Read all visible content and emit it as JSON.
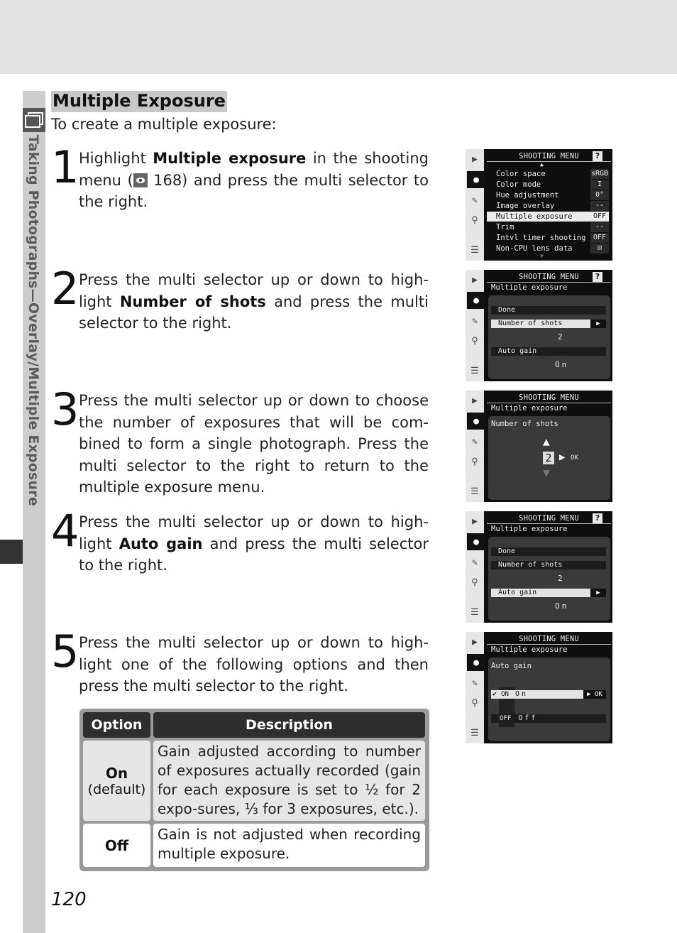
{
  "page": {
    "section_tab": "Taking Photographs—Overlay/Multiple Exposure",
    "title": "Multiple Exposure",
    "intro": "To create a multiple exposure:",
    "page_number": "120"
  },
  "steps": [
    {
      "num": "1",
      "parts": [
        "Highlight ",
        "Multiple exposure",
        " in the shooting menu (",
        "168) and press the multi selector to the right."
      ],
      "ref_icon": "menu-guide-icon"
    },
    {
      "num": "2",
      "parts": [
        "Press the multi selector up or down to high-light ",
        "Number of shots",
        " and press the multi selector to the right."
      ]
    },
    {
      "num": "3",
      "text": "Press the multi selector up or down to choose the number of exposures that will be com-bined to form a single photograph.  Press the multi selector to the right to return to the multiple exposure menu."
    },
    {
      "num": "4",
      "parts": [
        "Press the multi selector up or down to high-light ",
        "Auto gain",
        " and press the multi selector to the right."
      ]
    },
    {
      "num": "5",
      "text": "Press the multi selector up or down to high-light one of the following options and then press the multi selector to the right."
    }
  ],
  "table": {
    "headers": [
      "Option",
      "Description"
    ],
    "rows": [
      {
        "option": "On",
        "note": "(default)",
        "description": "Gain adjusted according to number of exposures actually recorded (gain for each exposure is set to ½ for 2 expo-sures, ⅓ for 3 exposures, etc.)."
      },
      {
        "option": "Off",
        "note": "",
        "description": "Gain is not adjusted when recording multiple exposure."
      }
    ]
  },
  "screens": {
    "header": "SHOOTING MENU",
    "help": "?",
    "submenu_title": "Multiple exposure",
    "rail_icons": [
      "playback-icon",
      "camera-icon",
      "pencil-icon",
      "wrench-icon",
      "custom-menu-icon"
    ],
    "s1": {
      "items": [
        {
          "label": "Color space",
          "value": "sRGB"
        },
        {
          "label": "Color mode",
          "value": "I"
        },
        {
          "label": "Hue adjustment",
          "value": "0°"
        },
        {
          "label": "Image overlay",
          "value": "--"
        },
        {
          "label": "Multiple exposure",
          "value": "OFF",
          "selected": true
        },
        {
          "label": "Trim",
          "value": "--"
        },
        {
          "label": "Intvl timer shooting",
          "value": "OFF"
        },
        {
          "label": "Non-CPU lens data",
          "value": "⊡"
        }
      ]
    },
    "s2": {
      "done": "Done",
      "shots_label": "Number of shots",
      "shots_value": "2",
      "gain_label": "Auto gain",
      "gain_value": "On"
    },
    "s3": {
      "label": "Number of shots",
      "value": "2",
      "ok": "OK"
    },
    "s5": {
      "label": "Auto gain",
      "on_code": "ON",
      "on_label": "On",
      "off_code": "OFF",
      "off_label": "Off",
      "ok": "OK"
    }
  }
}
